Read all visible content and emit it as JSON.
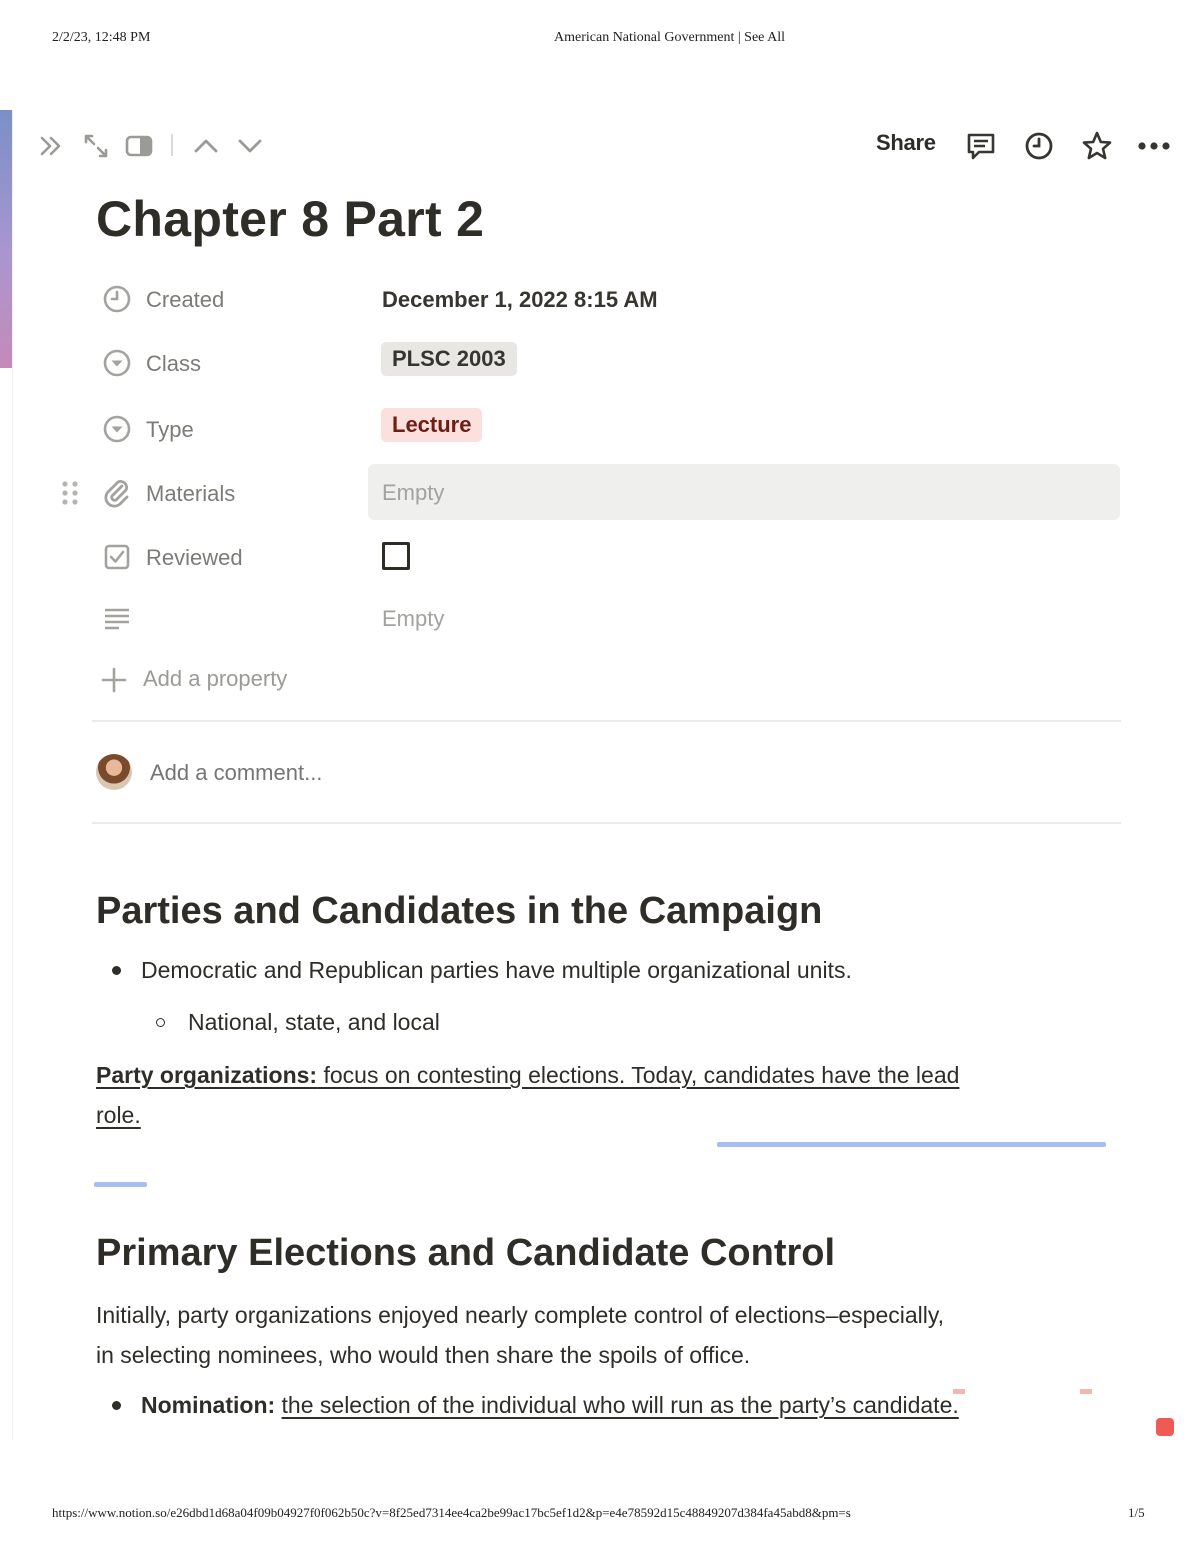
{
  "print": {
    "date": "2/2/23, 12:48 PM",
    "title": "American National Government | See All",
    "url": "https://www.notion.so/e26dbd1d68a04f09b04927f0f062b50c?v=8f25ed7314ee4ca2be99ac17bc5ef1d2&p=e4e78592d15c48849207d384fa45abd8&pm=s",
    "page_count": "1/5"
  },
  "topbar": {
    "share_label": "Share",
    "icons": [
      "expand-sidebar-icon",
      "open-full-page-icon",
      "side-peek-icon",
      "chevron-up-icon",
      "chevron-down-icon",
      "comment-icon",
      "clock-icon",
      "star-icon",
      "more-icon"
    ]
  },
  "page": {
    "title": "Chapter 8 Part 2"
  },
  "properties": {
    "created": {
      "name": "Created",
      "value": "December 1, 2022 8:15 AM"
    },
    "class": {
      "name": "Class",
      "value": "PLSC 2003"
    },
    "type": {
      "name": "Type",
      "value": "Lecture"
    },
    "materials": {
      "name": "Materials",
      "value": "Empty"
    },
    "reviewed": {
      "name": "Reviewed",
      "checked": false
    },
    "text": {
      "name": "",
      "value": "Empty"
    },
    "add_label": "Add a property"
  },
  "comment": {
    "placeholder": "Add a comment..."
  },
  "content": {
    "section1": {
      "heading": "Parties and Candidates in the Campaign",
      "bullet1": "Democratic and Republican parties have multiple organizational units.",
      "sub_bullet1": "National, state, and local",
      "para_term": "Party organizations:",
      "para_line1_rest": " focus on contesting elections. Today, candidates have the lead",
      "para_line2": "role."
    },
    "section2": {
      "heading": "Primary Elections and Candidate Control",
      "para_line1": "Initially, party organizations enjoyed nearly complete control of elections–especially,",
      "para_line2": "in selecting nominees, who would then share the spoils of office.",
      "bullet_term": "Nomination:",
      "bullet_def": "the selection of the individual who will run as the party’s candidate."
    }
  },
  "colors": {
    "text": "#37352f",
    "muted": "#7c7b77",
    "type_tag_bg": "#fbe0dd",
    "class_tag_bg": "#e8e7e4",
    "highlight_blue": "#a8bdf0"
  }
}
